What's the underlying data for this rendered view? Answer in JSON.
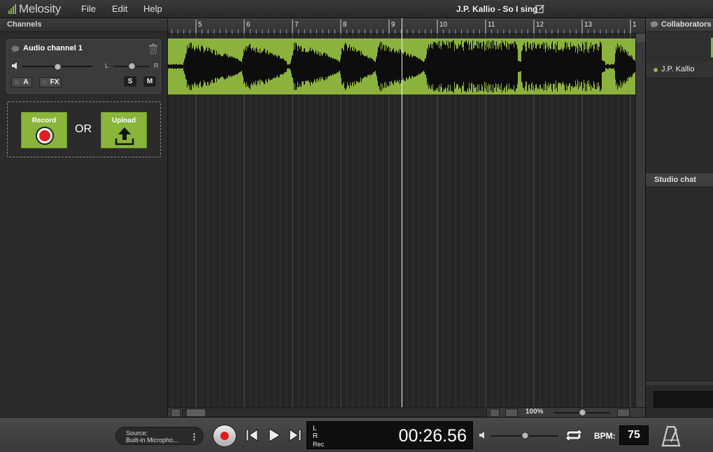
{
  "app": {
    "brand": "Melosity",
    "menus": {
      "file": "File",
      "edit": "Edit",
      "help": "Help"
    },
    "project_title": "J.P. Kallio - So I sing"
  },
  "channels": {
    "header": "Channels",
    "items": [
      {
        "name": "Audio channel 1",
        "volume": 0.5,
        "pan": 0.5,
        "pan_left": "L",
        "pan_right": "R",
        "buttons": {
          "a": "A",
          "fx": "FX",
          "solo": "S",
          "mute": "M"
        }
      }
    ],
    "add": {
      "record": "Record",
      "or": "OR",
      "upload": "Upload"
    }
  },
  "timeline": {
    "bar_labels": [
      "5",
      "6",
      "7",
      "8",
      "9",
      "10",
      "11",
      "12",
      "13",
      "1"
    ],
    "zoom_level": "100%",
    "zoom_slider": 0.5
  },
  "collaborators": {
    "header": "Collaborators",
    "users": [
      {
        "name": "J.P. Kallio",
        "online": true
      }
    ]
  },
  "studio_chat": {
    "header": "Studio chat"
  },
  "transport": {
    "source_label": "Source:",
    "source_value": "Built-in Micropho...",
    "level_left": "L",
    "level_right": "R",
    "rec_label": "Rec",
    "time": "00:26.56",
    "master_volume": 0.5,
    "bpm_label": "BPM:",
    "bpm": "75"
  },
  "colors": {
    "accent": "#8cb23e",
    "record_red": "#e01b1b",
    "waveform": "#0d0d0d"
  },
  "icons": [
    "speech-bubble-icon",
    "trash-icon",
    "speaker-icon",
    "record-icon",
    "upload-icon",
    "edit-icon",
    "menu-dots-icon",
    "skip-back-icon",
    "play-icon",
    "skip-forward-icon",
    "loop-icon",
    "metronome-icon"
  ]
}
